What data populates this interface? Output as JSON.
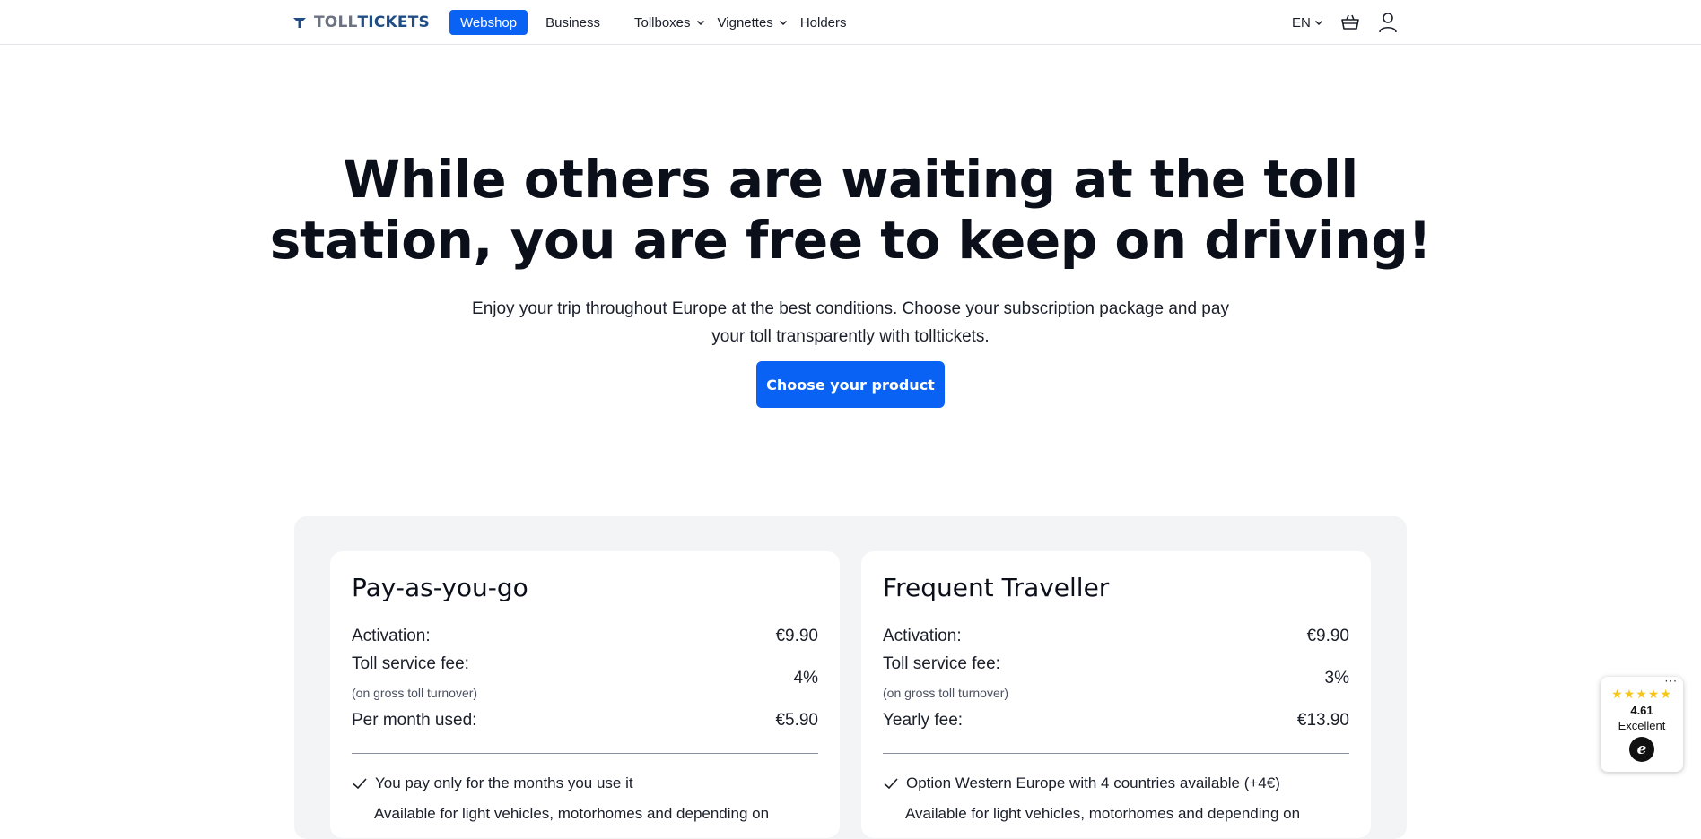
{
  "header": {
    "logo": {
      "part1": "TOLL",
      "part2": "TICKETS"
    },
    "nav": [
      {
        "label": "Webshop",
        "active": true
      },
      {
        "label": "Business"
      },
      {
        "label": "Tollboxes",
        "dropdown": true
      },
      {
        "label": "Vignettes",
        "dropdown": true
      },
      {
        "label": "Holders"
      }
    ],
    "language": "EN",
    "icons": [
      "cart-icon",
      "user-icon"
    ]
  },
  "hero": {
    "title_line1": "While others are waiting at the toll",
    "title_line2": "station, you are free to keep on driving!",
    "subtitle_line1": "Enjoy your trip throughout Europe at the best conditions. Choose your subscription package and pay",
    "subtitle_line2": "your toll transparently with tolltickets.",
    "cta_label": "Choose your product"
  },
  "plans": [
    {
      "title": "Pay-as-you-go",
      "rows": [
        {
          "label": "Activation:",
          "value": "€9.90"
        },
        {
          "label": "Toll service fee:",
          "value": "4%",
          "note": "(on gross toll turnover)"
        },
        {
          "label": "Per month used:",
          "value": "€5.90"
        }
      ],
      "features": [
        "You pay only for the months you use it",
        "Available for light vehicles, motorhomes and depending on"
      ]
    },
    {
      "title": "Frequent Traveller",
      "rows": [
        {
          "label": "Activation:",
          "value": "€9.90"
        },
        {
          "label": "Toll service fee:",
          "value": "3%",
          "note": "(on gross toll turnover)"
        },
        {
          "label": "Yearly fee:",
          "value": "€13.90"
        }
      ],
      "features": [
        "Option Western Europe with 4 countries available (+4€)",
        "Available for light vehicles, motorhomes and depending on"
      ]
    }
  ],
  "rating": {
    "stars": "★★★★★",
    "score": "4.61",
    "word": "Excellent",
    "seal": "e",
    "menu": "···"
  },
  "colors": {
    "accent": "#0a62f5",
    "logo_dark": "#1f4c84",
    "panel_bg": "#f3f4f6"
  }
}
